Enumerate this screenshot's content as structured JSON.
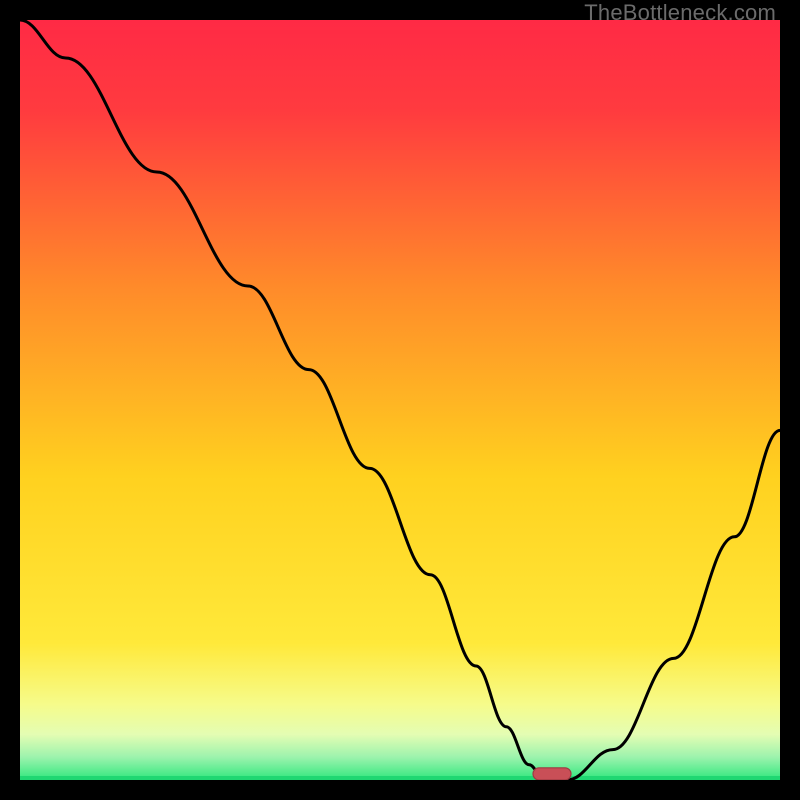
{
  "watermark": "TheBottleneck.com",
  "chart_data": {
    "type": "line",
    "title": "",
    "xlabel": "",
    "ylabel": "",
    "xlim": [
      0,
      100
    ],
    "ylim": [
      0,
      100
    ],
    "x": [
      0,
      6,
      18,
      30,
      38,
      46,
      54,
      60,
      64,
      67,
      69,
      72,
      78,
      86,
      94,
      100
    ],
    "values": [
      100,
      95,
      80,
      65,
      54,
      41,
      27,
      15,
      7,
      2,
      0,
      0,
      4,
      16,
      32,
      46
    ],
    "marker": {
      "x": 70,
      "y": 0,
      "w": 5,
      "h": 1.6
    },
    "background": {
      "top_color": "#ff2a45",
      "mid_color": "#ffd11f",
      "accent_color": "#f6fb8a",
      "bottom_color": "#2fe77d"
    },
    "annotations": []
  }
}
